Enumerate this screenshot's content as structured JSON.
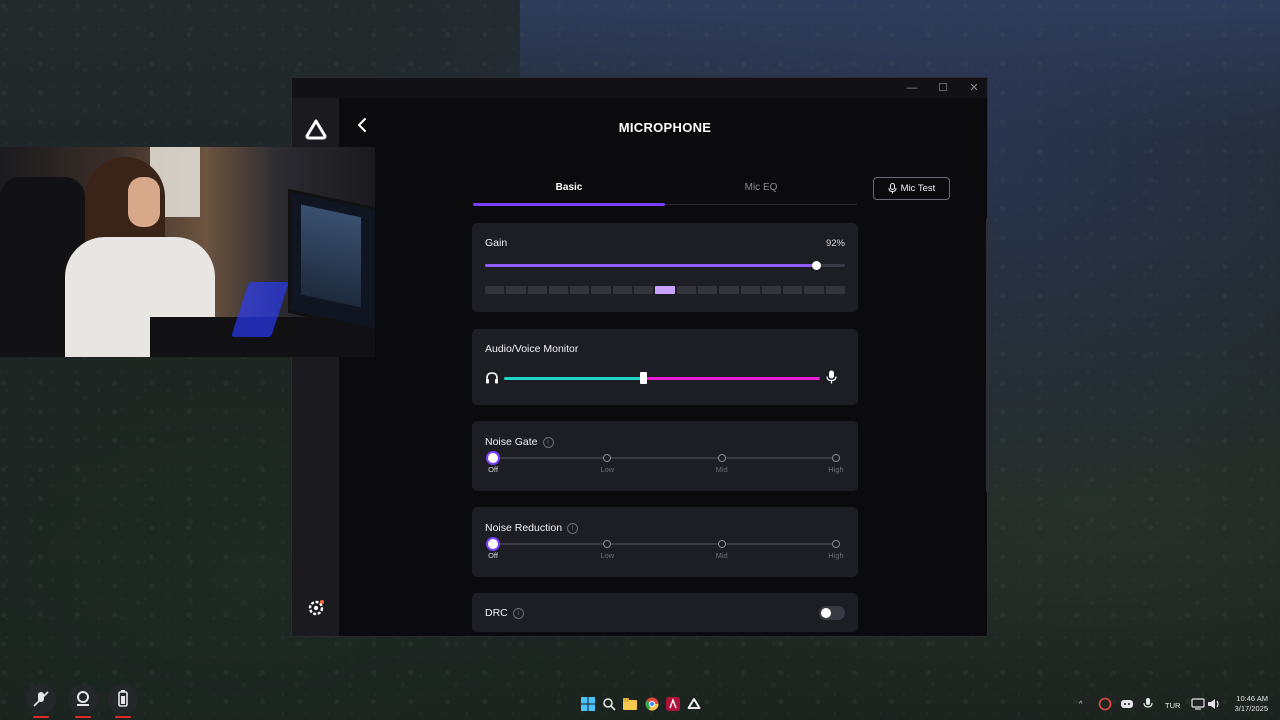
{
  "window": {
    "title": "MICROPHONE",
    "controls": {
      "minimize": "—",
      "maximize": "☐",
      "close": "✕"
    }
  },
  "tabs": [
    {
      "label": "Basic",
      "active": true
    },
    {
      "label": "Mic EQ",
      "active": false
    }
  ],
  "mic_test": {
    "label": "Mic Test",
    "icon": "microphone-icon"
  },
  "gain": {
    "title": "Gain",
    "value_text": "92%",
    "value": 0.92,
    "meter_segments": 17,
    "meter_active_index": 8
  },
  "monitor": {
    "title": "Audio/Voice Monitor",
    "left_icon": "headphones-icon",
    "right_icon": "microphone-icon",
    "balance": 0.44,
    "left_color": "#1fd6c8",
    "right_color": "#e81ed6"
  },
  "noise_gate": {
    "title": "Noise Gate",
    "options": [
      "Off",
      "Low",
      "Mid",
      "High"
    ],
    "selected": 0
  },
  "noise_reduction": {
    "title": "Noise Reduction",
    "options": [
      "Off",
      "Low",
      "Mid",
      "High"
    ],
    "selected": 0
  },
  "drc": {
    "title": "DRC",
    "enabled": false
  },
  "colors": {
    "accent": "#7a3cff",
    "gain_fill": "#8e5cff",
    "card_bg": "#1d1d24"
  },
  "tray": {
    "lang": "TUR",
    "time": "10:46 AM",
    "date": "3/17/2025"
  }
}
